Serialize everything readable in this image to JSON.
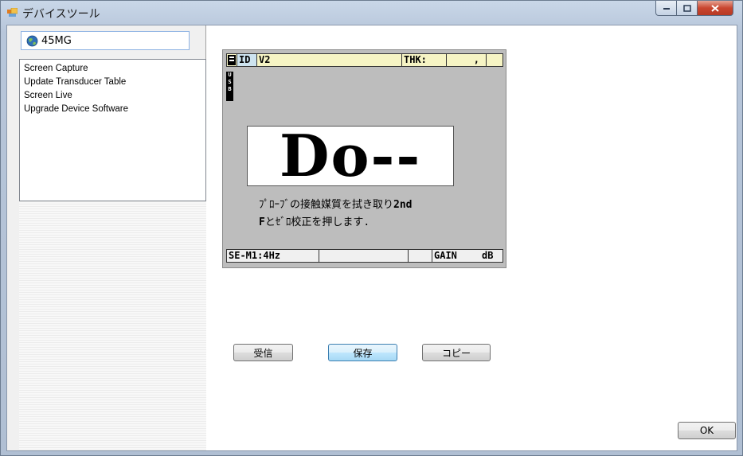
{
  "window": {
    "title": "デバイスツール",
    "controls": {
      "minimize_icon": "minimize-icon",
      "maximize_icon": "maximize-icon",
      "close_icon": "close-icon"
    }
  },
  "sidebar": {
    "device": {
      "icon": "device-globe-icon",
      "label": "45MG"
    },
    "items": [
      {
        "label": "Screen Capture",
        "selected": true
      },
      {
        "label": "Update Transducer Table"
      },
      {
        "label": "Screen Live"
      },
      {
        "label": "Upgrade Device Software"
      }
    ]
  },
  "lcd": {
    "top": {
      "id_label": "ID",
      "file": "V2",
      "thk": "THK:",
      "thk_value": ","
    },
    "usb": "USB",
    "reading": "Do--",
    "message_line1": "ﾌﾟﾛｰﾌﾞの接触媒質を拭き取り",
    "message_line1_key": "2nd",
    "message_line2_key": "F",
    "message_line2": "とｾﾞﾛ校正を押します.",
    "bottom": {
      "mode": "SE-M1:4Hz",
      "gain_label": "GAIN",
      "gain_unit": "dB"
    }
  },
  "buttons": {
    "receive": "受信",
    "save": "保存",
    "copy": "コピー",
    "ok": "OK"
  }
}
